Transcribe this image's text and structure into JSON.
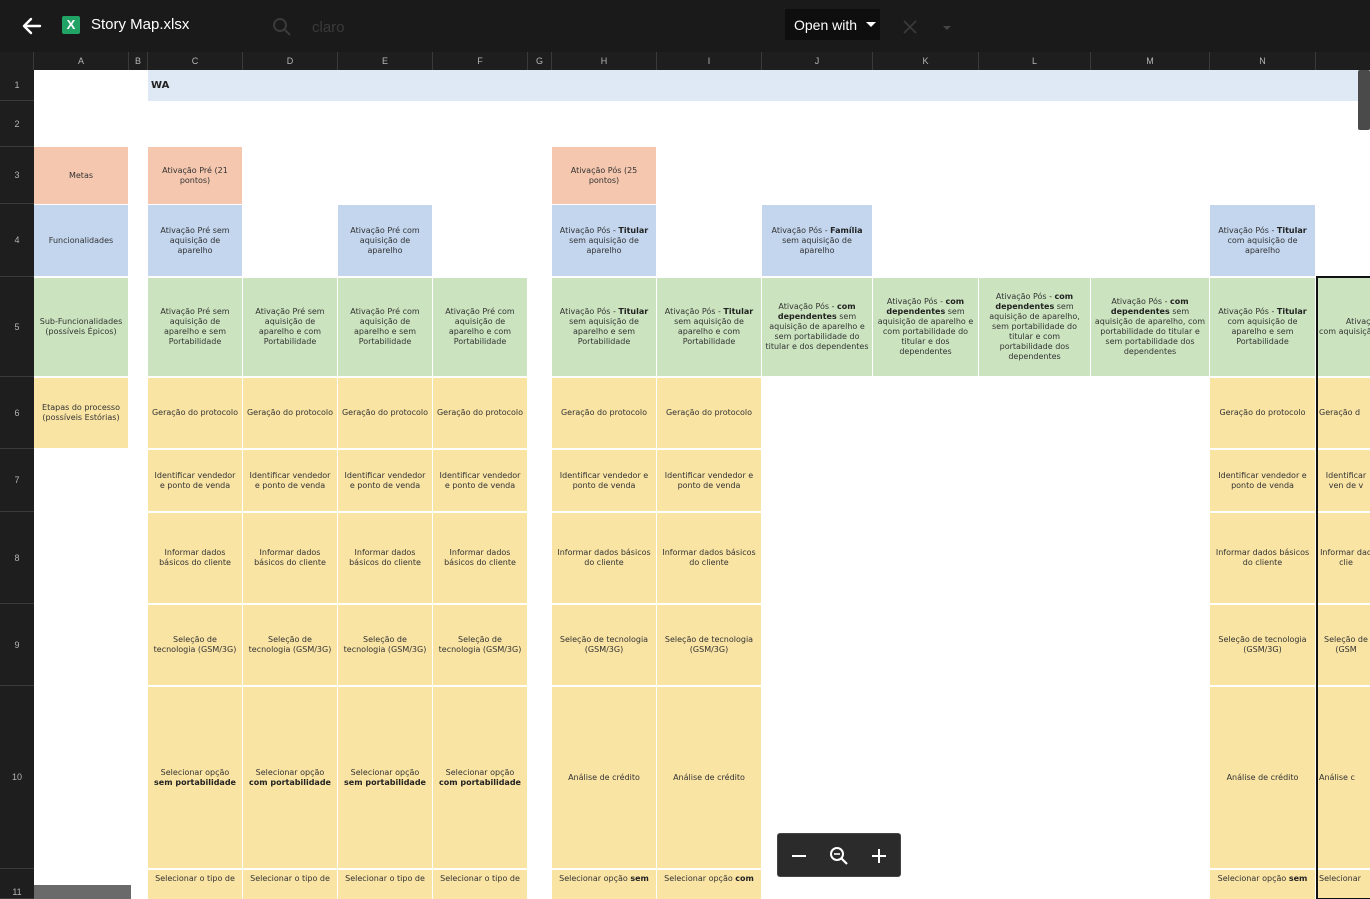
{
  "topbar": {
    "file_name": "Story Map.xlsx",
    "file_icon_letter": "X",
    "search_text": "claro",
    "open_with_label": "Open with"
  },
  "columns": [
    "A",
    "B",
    "C",
    "D",
    "E",
    "F",
    "G",
    "H",
    "I",
    "J",
    "K",
    "L",
    "M",
    "N",
    ""
  ],
  "rows": [
    "1",
    "2",
    "3",
    "4",
    "5",
    "6",
    "7",
    "8",
    "9",
    "10",
    "11"
  ],
  "sheet": {
    "title": "WA",
    "labels": {
      "metas": "Metas",
      "funcionalidades": "Funcionalidades",
      "sub_funcionalidades": "Sub-Funcionalidades (possíveis Épicos)",
      "etapas": "Etapas do processo (possíveis Estórias)"
    },
    "metas": {
      "pre": "Ativação Pré (21 pontos)",
      "pos": "Ativação Pós (25 pontos)"
    },
    "funcionalidades": {
      "c": "Ativação Pré sem aquisição de aparelho",
      "e": "Ativação Pré com aquisição de aparelho",
      "h_pre": "Ativação Pós - ",
      "h_bold": "Titular",
      "h_post": " sem aquisição de aparelho",
      "j_pre": "Ativação Pós - ",
      "j_bold": "Família",
      "j_post": " sem aquisição de aparelho",
      "n_pre": "Ativação Pós - ",
      "n_bold": "Titular",
      "n_post": " com aquisição de aparelho"
    },
    "sub": {
      "c": "Ativação Pré sem aquisição de aparelho e sem Portabilidade",
      "d": "Ativação Pré sem aquisição de aparelho e com Portabilidade",
      "e": "Ativação Pré com aquisição de aparelho e sem Portabilidade",
      "f": "Ativação Pré com aquisição de aparelho e com Portabilidade",
      "h_pre": "Ativação Pós - ",
      "h_bold": "Titular",
      "h_post": " sem aquisição de aparelho e sem Portabilidade",
      "i_pre": "Ativação Pós - ",
      "i_bold": "Titular",
      "i_post": " sem aquisição de aparelho e com Portabilidade",
      "j_pre": "Ativação Pós - ",
      "j_bold": "com dependentes",
      "j_post": " sem aquisição de aparelho e sem portabilidade do titular e dos dependentes",
      "k_pre": "Ativação Pós - ",
      "k_bold": "com dependentes",
      "k_post": " sem aquisição de aparelho e com portabilidade do titular e dos dependentes",
      "l_pre": "Ativação Pós - ",
      "l_bold": "com dependentes",
      "l_post": " sem aquisição de aparelho, sem portabilidade do titular e com portabilidade dos dependentes",
      "m_pre": "Ativação Pós - ",
      "m_bold": "com dependentes",
      "m_post": " sem aquisição de aparelho, com portabilidade do titular e sem portabilidade dos dependentes",
      "n_pre": "Ativação Pós - ",
      "n_bold": "Titular",
      "n_post": " com aquisição de aparelho e sem Portabilidade",
      "o_pre": "Ativação P",
      "o_post": " com aquisição com Port"
    },
    "etapas": {
      "geracao": "Geração do protocolo",
      "geracao_cut": "Geração d",
      "identificar": "Identificar vendedor e ponto de venda",
      "identificar_n": "Identificar vendedor e ponto de venda",
      "identificar_cut": "Identificar ven de v",
      "informar": "Informar dados básicos do cliente",
      "informar_cut": "Informar dad clie",
      "selecao": "Seleção de tecnologia (GSM/3G)",
      "selecao_cut": "Seleção de (GSM",
      "sel_sem_pre": "Selecionar opção ",
      "sel_sem_bold": "sem",
      "sel_sem_post": " portabilidade",
      "sel_com_pre": "Selecionar opção ",
      "sel_com_bold": "com",
      "sel_com_post": " portabilidade",
      "analise": "Análise de crédito",
      "analise_cut": "Análise c",
      "tipo": "Selecionar o tipo de",
      "opcao_sem_pre": "Selecionar opção ",
      "opcao_sem_bold": "sem",
      "opcao_com_pre": "Selecionar opção ",
      "opcao_com_bold": "com",
      "selecionar_cut": "Selecionar"
    }
  },
  "colors": {
    "pink": "#f4c7ae",
    "blue": "#c3d6ee",
    "green": "#cbe4bf",
    "yellow": "#f9e4a4",
    "title_band": "#dfe9f5"
  }
}
